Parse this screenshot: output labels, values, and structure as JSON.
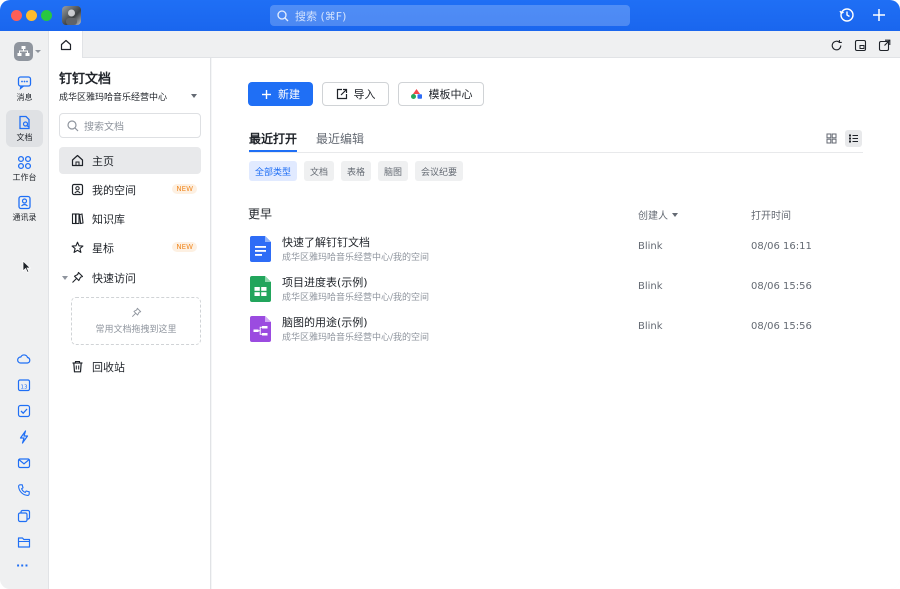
{
  "titlebar": {
    "search_placeholder": "搜索 (⌘F)",
    "icons": [
      "history-icon",
      "plus-icon"
    ]
  },
  "rail": {
    "items": [
      {
        "label": "消息",
        "icon": "message-icon"
      },
      {
        "label": "文档",
        "icon": "doc-icon",
        "active": true
      },
      {
        "label": "工作台",
        "icon": "workbench-icon"
      },
      {
        "label": "通讯录",
        "icon": "contacts-icon"
      }
    ],
    "bottom_icons": [
      "cloud-icon",
      "calendar-icon",
      "todo-icon",
      "flash-icon",
      "mail-icon",
      "phone-icon",
      "copy-icon",
      "folder-icon",
      "more-icon"
    ],
    "calendar_day": "13",
    "more_label": "···"
  },
  "sidebar": {
    "title": "钉钉文档",
    "org": "成华区雅玛哈音乐经营中心",
    "search_placeholder": "搜索文档",
    "nav": [
      {
        "label": "主页",
        "icon": "home-icon",
        "active": true
      },
      {
        "label": "我的空间",
        "icon": "my-space-icon",
        "badge": "NEW"
      },
      {
        "label": "知识库",
        "icon": "knowledge-icon"
      },
      {
        "label": "星标",
        "icon": "star-icon",
        "badge": "NEW"
      },
      {
        "label": "快速访问",
        "icon": "pin-icon"
      }
    ],
    "quick_hint": "常用文档拖拽到这里",
    "trash_label": "回收站"
  },
  "main": {
    "buttons": {
      "new": "新建",
      "import": "导入",
      "templates": "模板中心"
    },
    "tabs": [
      "最近打开",
      "最近编辑"
    ],
    "filters": [
      "全部类型",
      "文档",
      "表格",
      "脑图",
      "会议纪要"
    ],
    "section_title": "更早",
    "columns": {
      "owner": "创建人",
      "time": "打开时间"
    },
    "files": [
      {
        "name": "快速了解钉钉文档",
        "path": "成华区雅玛哈音乐经营中心/我的空间",
        "owner": "Blink",
        "time": "08/06 16:11",
        "type": "doc",
        "color": "#2e6cf6"
      },
      {
        "name": "项目进度表(示例)",
        "path": "成华区雅玛哈音乐经营中心/我的空间",
        "owner": "Blink",
        "time": "08/06 15:56",
        "type": "sheet",
        "color": "#22a55c"
      },
      {
        "name": "脑图的用途(示例)",
        "path": "成华区雅玛哈音乐经营中心/我的空间",
        "owner": "Blink",
        "time": "08/06 15:56",
        "type": "mindmap",
        "color": "#9b4be0"
      }
    ]
  },
  "colors": {
    "accent": "#1f6ff5",
    "badge": "#f08a24"
  }
}
